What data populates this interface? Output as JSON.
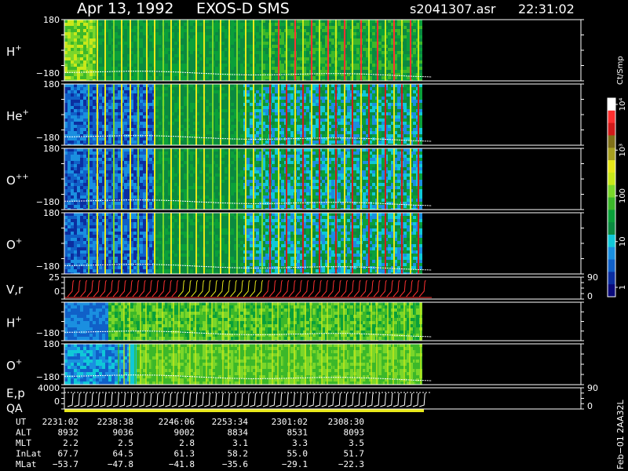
{
  "header": {
    "date": "Apr 13, 1992",
    "instrument": "EXOS-D SMS",
    "file": "s2041307.asr",
    "time": "22:31:02"
  },
  "colorbar": {
    "unit": "Ct/Smp",
    "tick_labels": [
      "1",
      "10",
      "100",
      "10³",
      "10⁴"
    ],
    "colors": [
      "#0a0a7a",
      "#0b2ea0",
      "#1060c8",
      "#1a8fe0",
      "#10c8d8",
      "#0a8a40",
      "#0aa03a",
      "#3cb82a",
      "#7ad62a",
      "#c8e81a",
      "#e8e81a",
      "#a8a020",
      "#807018",
      "#d01a1a",
      "#ff3030",
      "#ffffff"
    ]
  },
  "panels": [
    {
      "id": "h-plus",
      "label": "H",
      "sup": "+",
      "ymax": "180",
      "ymin": "−180",
      "right_top": "",
      "right_bottom": ""
    },
    {
      "id": "he-plus",
      "label": "He",
      "sup": "+",
      "ymax": "180",
      "ymin": "−180",
      "right_top": "",
      "right_bottom": ""
    },
    {
      "id": "o-plus-plus",
      "label": "O",
      "sup": "++",
      "ymax": "180",
      "ymin": "−180",
      "right_top": "",
      "right_bottom": ""
    },
    {
      "id": "o-plus",
      "label": "O",
      "sup": "+",
      "ymax": "180",
      "ymin": "−180",
      "right_top": "",
      "right_bottom": ""
    },
    {
      "id": "vr",
      "label": "V,r",
      "sup": "",
      "ymax": "25",
      "ymin": "0",
      "right_top": "90",
      "right_bottom": "0"
    },
    {
      "id": "h-plus-2",
      "label": "H",
      "sup": "+",
      "ymax": "",
      "ymin": "−180",
      "right_top": "",
      "right_bottom": ""
    },
    {
      "id": "o-plus-2",
      "label": "O",
      "sup": "+",
      "ymax": "180",
      "ymin": "−180",
      "right_top": "",
      "right_bottom": ""
    },
    {
      "id": "ep-qa",
      "label": "E,p",
      "sup": "",
      "label2": "QA",
      "ymax": "4000",
      "ymin": "0",
      "right_top": "90",
      "right_bottom": "0"
    }
  ],
  "chart_data": {
    "type": "heatmap",
    "x_axis": {
      "rows": [
        {
          "label": "UT",
          "values": [
            "2231:02",
            "2238:38",
            "2246:06",
            "2253:34",
            "2301:02",
            "2308:30"
          ]
        },
        {
          "label": "ALT",
          "values": [
            "8932",
            "9036",
            "9002",
            "8834",
            "8531",
            "8093"
          ]
        },
        {
          "label": "MLT",
          "values": [
            "2.2",
            "2.5",
            "2.8",
            "3.1",
            "3.3",
            "3.5"
          ]
        },
        {
          "label": "InLat",
          "values": [
            "67.7",
            "64.5",
            "61.3",
            "58.2",
            "55.0",
            "51.7"
          ]
        },
        {
          "label": "MLat",
          "values": [
            "−53.7",
            "−47.8",
            "−41.8",
            "−35.6",
            "−29.1",
            "−22.3"
          ]
        }
      ]
    }
  },
  "footer_label": "Feb−01 2AA32L"
}
